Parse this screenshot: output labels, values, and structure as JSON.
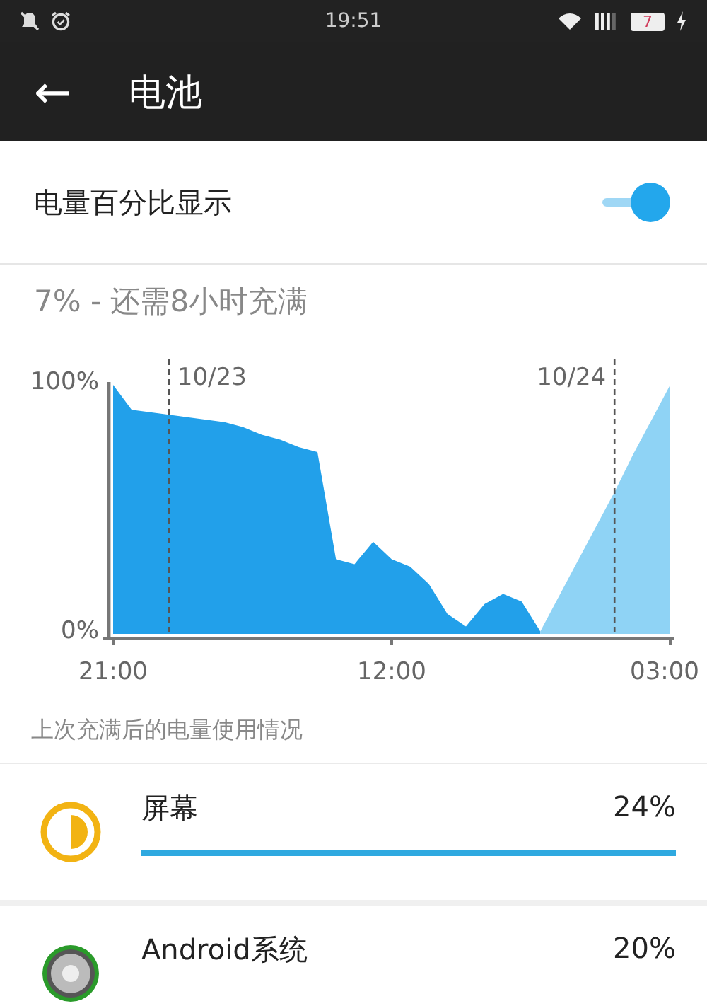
{
  "status_bar": {
    "time": "19:51",
    "battery": "7"
  },
  "header": {
    "back": "←",
    "title": "电池"
  },
  "percentage_setting": {
    "label": "电量百分比显示",
    "on": true
  },
  "summary": "7% - 还需8小时充满",
  "chart": {
    "chart_data": {
      "type": "area",
      "categories": [
        "21:00",
        null,
        null,
        null,
        null,
        null,
        null,
        null,
        null,
        null,
        null,
        null,
        null,
        null,
        null,
        "12:00",
        null,
        null,
        null,
        null,
        null,
        null,
        null,
        null,
        null,
        null,
        null,
        null,
        null,
        null,
        "03:00"
      ],
      "series": [
        {
          "color": "#22a0ea",
          "values": [
            100,
            90,
            89,
            88,
            87,
            86,
            85,
            83,
            80,
            78,
            75,
            73,
            30,
            28,
            37,
            30,
            27,
            20,
            8,
            3,
            12,
            16,
            13,
            1,
            null,
            null,
            null,
            null,
            null,
            null,
            null
          ]
        },
        {
          "color": "#8fd3f5",
          "values": [
            null,
            null,
            null,
            null,
            null,
            null,
            null,
            null,
            null,
            null,
            null,
            null,
            null,
            null,
            null,
            null,
            null,
            null,
            null,
            null,
            null,
            null,
            null,
            1,
            15,
            29,
            43,
            57,
            72,
            86,
            100
          ]
        }
      ],
      "ylim": [
        0,
        100
      ],
      "yticks": [
        {
          "value": 0,
          "label": "0%"
        },
        {
          "value": 100,
          "label": "100%"
        }
      ]
    },
    "date_labels": [
      "10/23",
      "10/24"
    ]
  },
  "usage_caption": "上次充满后的电量使用情况",
  "usage_items": [
    {
      "kind": "screen",
      "name": "屏幕",
      "percent": "24%"
    },
    {
      "kind": "system",
      "name": "Android系统",
      "percent": "20%"
    }
  ]
}
